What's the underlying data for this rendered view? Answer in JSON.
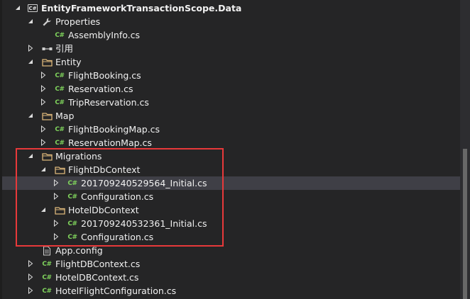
{
  "solution_explorer": {
    "project": {
      "label": "EntityFrameworkTransactionScope.Data",
      "icon": "csharp-project-icon"
    },
    "items": [
      {
        "label": "Properties",
        "icon": "wrench-icon"
      },
      {
        "label": "AssemblyInfo.cs",
        "icon": "csharp-file-icon"
      },
      {
        "label": "引用",
        "icon": "references-icon"
      },
      {
        "label": "Entity",
        "icon": "folder-icon"
      },
      {
        "label": "FlightBooking.cs",
        "icon": "csharp-file-icon"
      },
      {
        "label": "Reservation.cs",
        "icon": "csharp-file-icon"
      },
      {
        "label": "TripReservation.cs",
        "icon": "csharp-file-icon"
      },
      {
        "label": "Map",
        "icon": "folder-icon"
      },
      {
        "label": "FlightBookingMap.cs",
        "icon": "csharp-file-icon"
      },
      {
        "label": "ReservationMap.cs",
        "icon": "csharp-file-icon"
      },
      {
        "label": "Migrations",
        "icon": "folder-icon"
      },
      {
        "label": "FlightDbContext",
        "icon": "folder-icon"
      },
      {
        "label": "201709240529564_Initial.cs",
        "icon": "csharp-file-icon"
      },
      {
        "label": "Configuration.cs",
        "icon": "csharp-file-icon"
      },
      {
        "label": "HotelDbContext",
        "icon": "folder-icon"
      },
      {
        "label": "201709240532361_Initial.cs",
        "icon": "csharp-file-icon"
      },
      {
        "label": "Configuration.cs",
        "icon": "csharp-file-icon"
      },
      {
        "label": "App.config",
        "icon": "config-file-icon"
      },
      {
        "label": "FlightDBContext.cs",
        "icon": "csharp-file-icon"
      },
      {
        "label": "HotelDBContext.cs",
        "icon": "csharp-file-icon"
      },
      {
        "label": "HotelFlightConfiguration.cs",
        "icon": "csharp-file-icon"
      }
    ],
    "cs_glyph": "C#",
    "colors": {
      "background": "#252526",
      "text": "#f1f1f1",
      "csharp": "#7fd35c",
      "folder": "#dcb67a",
      "selected": "#3f3f46",
      "highlight_border": "#e8393a"
    }
  }
}
